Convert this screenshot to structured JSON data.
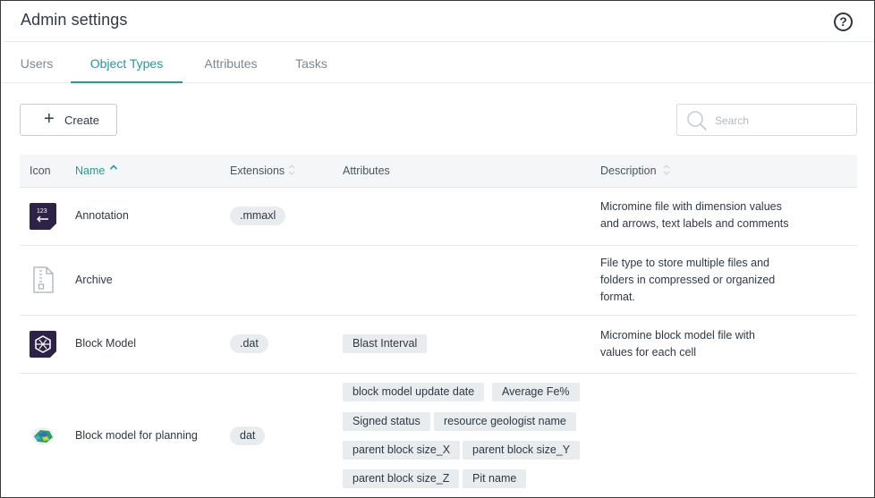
{
  "header": {
    "title": "Admin settings",
    "help_icon": "question-circle-icon",
    "help_glyph": "?"
  },
  "tabs": [
    {
      "label": "Users",
      "active": false
    },
    {
      "label": "Object Types",
      "active": true
    },
    {
      "label": "Attributes",
      "active": false
    },
    {
      "label": "Tasks",
      "active": false
    }
  ],
  "toolbar": {
    "create_label": "Create",
    "create_icon": "plus-icon",
    "plus_glyph": "+",
    "search_placeholder": "Search",
    "search_value": "",
    "search_icon": "search-icon"
  },
  "table": {
    "columns": {
      "icon": "Icon",
      "name": "Name",
      "extensions": "Extensions",
      "attributes": "Attributes",
      "description": "Description"
    },
    "sort": {
      "column": "name",
      "direction": "ascending"
    },
    "rows": [
      {
        "icon": "annotation-icon",
        "name": "Annotation",
        "extension": ".mmaxl",
        "attributes": [],
        "description": [
          "Micromine file with dimension values",
          "and arrows, text labels and comments"
        ]
      },
      {
        "icon": "archive-zip-icon",
        "name": "Archive",
        "extension": "",
        "attributes": [],
        "description": [
          "File type to store multiple files and",
          "folders in compressed or organized",
          "format."
        ]
      },
      {
        "icon": "block-model-icon",
        "name": "Block Model",
        "extension": ".dat",
        "attributes": [
          "Blast Interval"
        ],
        "description": [
          "Micromine block model file with",
          "values for each cell"
        ]
      },
      {
        "icon": "block-model-planning-icon",
        "name": "Block model for planning",
        "extension": "dat",
        "attributes": [
          "block model update date",
          "Average Fe%",
          "Signed status",
          "resource geologist name",
          "parent block size_X",
          "parent block size_Y",
          "parent block size_Z",
          "Pit name"
        ],
        "description": []
      }
    ]
  },
  "icon_text": {
    "annotation": "123"
  },
  "colors": {
    "accent": "#1f9a9a",
    "icon_dark": "#2e2347",
    "chip_bg": "#e8ecef",
    "header_bg": "#f4f6f8"
  }
}
